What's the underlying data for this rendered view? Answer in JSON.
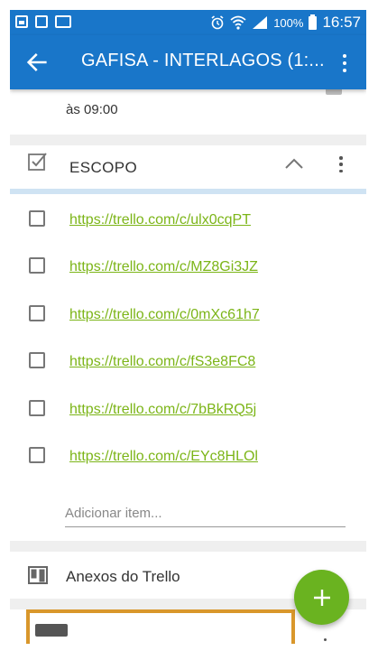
{
  "status_bar": {
    "battery": "100%",
    "time": "16:57"
  },
  "app_bar": {
    "title": "GAFISA - INTERLAGOS (1:..."
  },
  "previous_card": {
    "partial_text": "às 09:00"
  },
  "checklist": {
    "title": "ESCOPO",
    "items": [
      {
        "label": "https://trello.com/c/ulx0cqPT",
        "checked": false
      },
      {
        "label": "https://trello.com/c/MZ8Gi3JZ",
        "checked": false
      },
      {
        "label": "https://trello.com/c/0mXc61h7",
        "checked": false
      },
      {
        "label": "https://trello.com/c/fS3e8FC8",
        "checked": false
      },
      {
        "label": "https://trello.com/c/7bBkRQ5j",
        "checked": false
      },
      {
        "label": "https://trello.com/c/EYc8HLOl",
        "checked": false
      }
    ],
    "add_item_placeholder": "Adicionar item..."
  },
  "attachments": {
    "title": "Anexos do Trello"
  },
  "colors": {
    "primary": "#1976c9",
    "accent_green": "#6ab320",
    "link_green": "#7cb518",
    "thumbnail_border": "#d9972b"
  },
  "icons": {
    "back": "arrow-left-icon",
    "overflow": "more-vert-icon",
    "checklist": "checkbox-checked-icon",
    "collapse": "chevron-up-icon",
    "attachments": "trello-board-icon",
    "fab": "plus-icon"
  }
}
